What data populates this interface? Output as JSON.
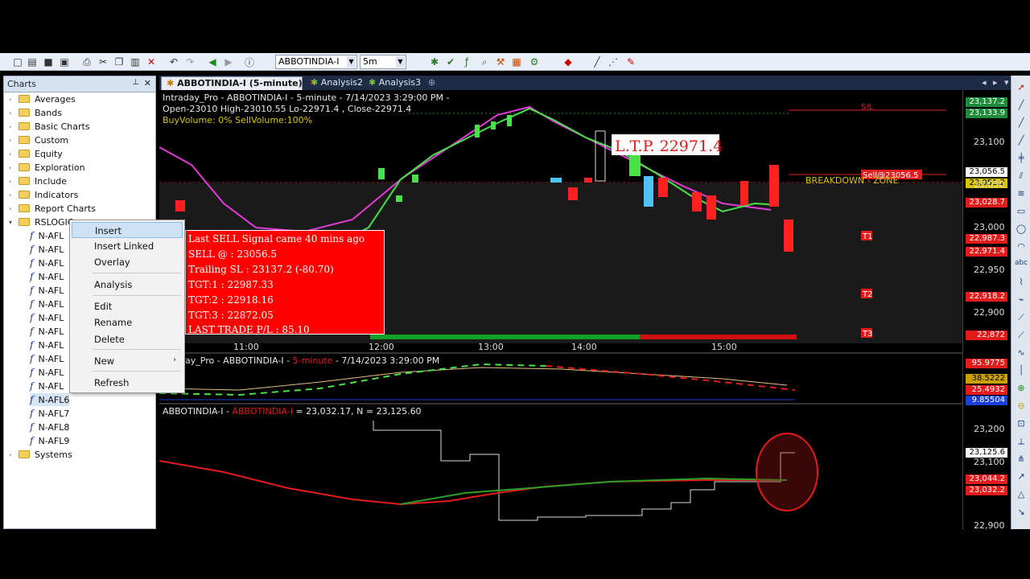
{
  "toolbar": {
    "symbol": "ABBOTINDIA-I",
    "interval": "5m"
  },
  "charts_panel": {
    "title": "Charts",
    "folders": [
      "Averages",
      "Bands",
      "Basic Charts",
      "Custom",
      "Equity",
      "Exploration",
      "Include",
      "Indicators",
      "Report Charts",
      "RSLOGIC"
    ],
    "rslogic_items": [
      "N-AFL",
      "N-AFL",
      "N-AFL",
      "N-AFL",
      "N-AFL",
      "N-AFL",
      "N-AFL",
      "N-AFL",
      "N-AFL",
      "N-AFL",
      "N-AFL",
      "N-AFL",
      "N-AFL6",
      "N-AFL7",
      "N-AFL8",
      "N-AFL9"
    ],
    "last_folder": "Systems"
  },
  "context_menu": {
    "items": [
      "Insert",
      "Insert Linked",
      "Overlay",
      "Analysis",
      "Edit",
      "Rename",
      "Delete",
      "New",
      "Refresh"
    ]
  },
  "tabs": [
    {
      "label": "ABBOTINDIA-I (5-minute)"
    },
    {
      "label": "Analysis2"
    },
    {
      "label": "Analysis3"
    }
  ],
  "main_pane": {
    "header_line1": "Intraday_Pro - ABBOTINDIA-I - 5-minute - 7/14/2023 3:29:00 PM -",
    "header_line2": "Open-23010  High-23010.55  Lo-22971.4  , Close-22971.4",
    "header_line3": "BuyVolume: 0%  SellVolume:100%",
    "ltp_label": "L.T.P.  22971.4",
    "sl_label": "S/L",
    "sell_label": "Sell@23056.5",
    "breakdown_label": "BREAKDOWN - ZONE",
    "targets": [
      "T1",
      "T2",
      "T3"
    ],
    "time_labels": [
      "11:00",
      "12:00",
      "13:00",
      "14:00",
      "15:00"
    ],
    "price_ticks": [
      "23,100",
      "23,050",
      "23,000",
      "22,950",
      "22,900"
    ],
    "price_tags": [
      {
        "text": "23,137.2",
        "color": "#1e8a3a"
      },
      {
        "text": "23,133.9",
        "color": "#1e8a3a"
      },
      {
        "text": "23,056.5",
        "color": "#ffffff"
      },
      {
        "text": "23,051.2",
        "color": "#d8c400"
      },
      {
        "text": "23,028.7",
        "color": "#e31b1b"
      },
      {
        "text": "22,987.3",
        "color": "#e31b1b"
      },
      {
        "text": "22,971.4",
        "color": "#e31b1b"
      },
      {
        "text": "22,918.2",
        "color": "#e31b1b"
      },
      {
        "text": "22,872",
        "color": "#e31b1b"
      }
    ]
  },
  "signal_box": {
    "lines": [
      "Last SELL Signal came 40 mins ago",
      "SELL @ : 23056.5",
      " Trailing SL : 23137.2 (-80.70)",
      "TGT:1 : 22987.33",
      "TGT:2 : 22918.16",
      "TGT:3 : 22872.05",
      "LAST TRADE P/L : 85.10"
    ]
  },
  "mid_pane": {
    "header_prefix": "ay_Pro - ABBOTINDIA-I - ",
    "header_interval": "5-minute",
    "header_suffix": " - 7/14/2023 3:29:00 PM",
    "tags": [
      {
        "text": "95.9775",
        "color": "#e31b1b"
      },
      {
        "text": "38.5222",
        "color": "#c8a000"
      },
      {
        "text": "25.4932",
        "color": "#e31b1b"
      },
      {
        "text": "9.85504",
        "color": "#1a3fd8"
      }
    ]
  },
  "lower_pane": {
    "header_prefix": "ABBOTINDIA-I - ",
    "header_symbol": "ABBOTINDIA-I",
    "header_suffix": " = 23,032.17, N = 23,125.60",
    "price_ticks": [
      "23,200",
      "23,100",
      "22,900"
    ],
    "tags": [
      {
        "text": "23,125.6",
        "color": "#ffffff"
      },
      {
        "text": "23,044.2",
        "color": "#e31b1b"
      },
      {
        "text": "23,032.2",
        "color": "#e31b1b"
      }
    ]
  }
}
